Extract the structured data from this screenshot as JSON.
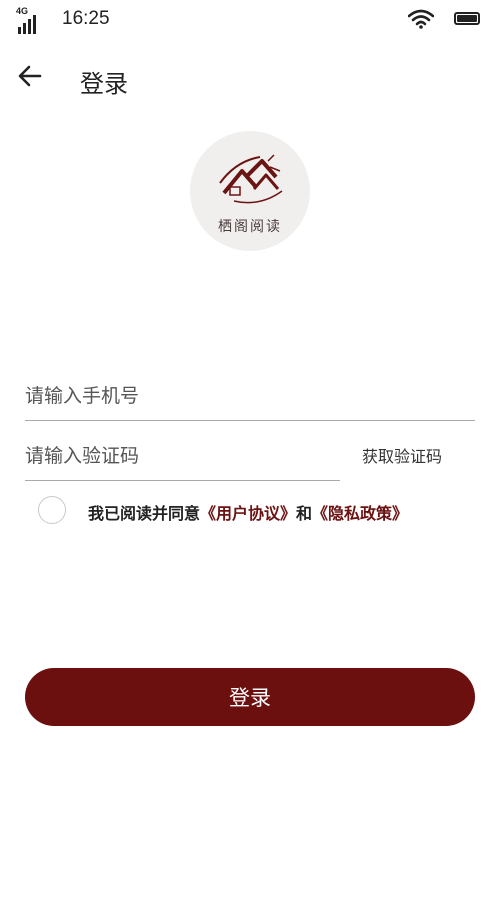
{
  "status_bar": {
    "network": "4G",
    "time": "16:25"
  },
  "header": {
    "title": "登录",
    "back_icon": "arrow-left-icon"
  },
  "logo": {
    "text": "栖阁阅读"
  },
  "form": {
    "phone_placeholder": "请输入手机号",
    "phone_value": "",
    "code_placeholder": "请输入验证码",
    "code_value": "",
    "get_code_label": "获取验证码"
  },
  "agreement": {
    "prefix": "我已阅读并同意",
    "user_agreement": "《用户协议》",
    "conjunction": "和",
    "privacy_policy": "《隐私政策》",
    "checked": false
  },
  "login_button": {
    "label": "登录"
  },
  "colors": {
    "accent": "#6b0f0f",
    "link": "#6b1212"
  }
}
